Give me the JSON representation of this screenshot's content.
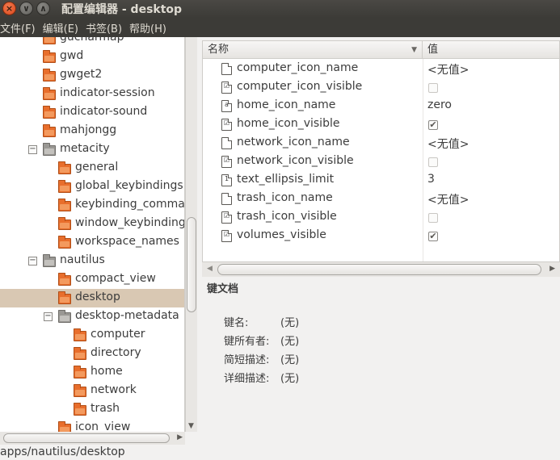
{
  "window": {
    "title": "配置编辑器 - desktop",
    "close_glyph": "×",
    "min_glyph": "∨",
    "max_glyph": "∧"
  },
  "menubar": {
    "items": [
      "文件(F)",
      "编辑(E)",
      "书签(B)",
      "帮助(H)"
    ]
  },
  "tree": {
    "items": [
      {
        "label": "gucharmap",
        "depth": 1
      },
      {
        "label": "gwd",
        "depth": 1
      },
      {
        "label": "gwget2",
        "depth": 1
      },
      {
        "label": "indicator-session",
        "depth": 1
      },
      {
        "label": "indicator-sound",
        "depth": 1
      },
      {
        "label": "mahjongg",
        "depth": 1
      },
      {
        "label": "metacity",
        "depth": 1,
        "expanded": true
      },
      {
        "label": "general",
        "depth": 2
      },
      {
        "label": "global_keybindings",
        "depth": 2
      },
      {
        "label": "keybinding_commands",
        "depth": 2
      },
      {
        "label": "window_keybindings",
        "depth": 2
      },
      {
        "label": "workspace_names",
        "depth": 2
      },
      {
        "label": "nautilus",
        "depth": 1,
        "expanded": true
      },
      {
        "label": "compact_view",
        "depth": 2
      },
      {
        "label": "desktop",
        "depth": 2,
        "selected": true
      },
      {
        "label": "desktop-metadata",
        "depth": 2,
        "expanded": true
      },
      {
        "label": "computer",
        "depth": 3
      },
      {
        "label": "directory",
        "depth": 3
      },
      {
        "label": "home",
        "depth": 3
      },
      {
        "label": "network",
        "depth": 3
      },
      {
        "label": "trash",
        "depth": 3
      },
      {
        "label": "icon_view",
        "depth": 2
      }
    ],
    "expander_glyph": "−"
  },
  "keylist": {
    "header_name": "名称",
    "header_value": "值",
    "sort_glyph": "▼",
    "rows": [
      {
        "name": "computer_icon_name",
        "type": "string",
        "value": "<无值>"
      },
      {
        "name": "computer_icon_visible",
        "type": "bool",
        "checked": false
      },
      {
        "name": "home_icon_name",
        "type": "string-a",
        "value": "zero"
      },
      {
        "name": "home_icon_visible",
        "type": "bool",
        "checked": true
      },
      {
        "name": "network_icon_name",
        "type": "string",
        "value": "<无值>"
      },
      {
        "name": "network_icon_visible",
        "type": "bool",
        "checked": false
      },
      {
        "name": "text_ellipsis_limit",
        "type": "int",
        "value": "3"
      },
      {
        "name": "trash_icon_name",
        "type": "string",
        "value": "<无值>"
      },
      {
        "name": "trash_icon_visible",
        "type": "bool",
        "checked": false
      },
      {
        "name": "volumes_visible",
        "type": "bool",
        "checked": true
      }
    ]
  },
  "docs": {
    "title": "键文档",
    "fields": [
      {
        "label": "键名:",
        "value": "(无)"
      },
      {
        "label": "键所有者:",
        "value": "(无)"
      },
      {
        "label": "简短描述:",
        "value": "(无)"
      },
      {
        "label": "详细描述:",
        "value": "(无)"
      }
    ]
  },
  "statusbar": {
    "path": "apps/nautilus/desktop"
  },
  "colors": {
    "selection": "#d9c8b3",
    "folder": "#e86e2c",
    "titlebar": "#3c3b37"
  }
}
